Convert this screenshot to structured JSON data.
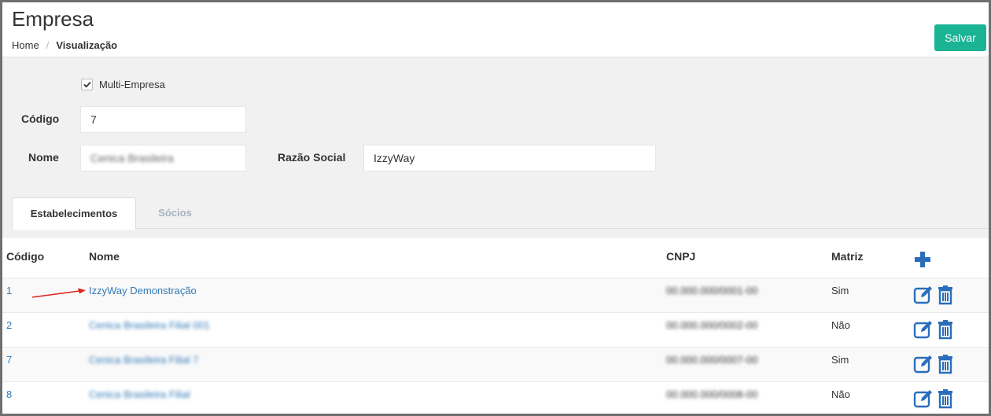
{
  "header": {
    "title": "Empresa",
    "breadcrumb_home": "Home",
    "breadcrumb_sep": "/",
    "breadcrumb_current": "Visualização",
    "save_label": "Salvar"
  },
  "form": {
    "multi_empresa_label": "Multi-Empresa",
    "multi_empresa_checked": true,
    "codigo_label": "Código",
    "codigo_value": "7",
    "nome_label": "Nome",
    "nome_value": "Cenica Brasileira",
    "razao_label": "Razão Social",
    "razao_value": "IzzyWay"
  },
  "tabs": [
    {
      "label": "Estabelecimentos",
      "active": true
    },
    {
      "label": "Sócios",
      "active": false
    }
  ],
  "table": {
    "headers": {
      "codigo": "Código",
      "nome": "Nome",
      "cnpj": "CNPJ",
      "matriz": "Matriz"
    },
    "rows": [
      {
        "codigo": "1",
        "nome": "IzzyWay Demonstração",
        "cnpj": "00.000.000/0001-00",
        "matriz": "Sim",
        "blurred": false
      },
      {
        "codigo": "2",
        "nome": "Cenica Brasileira Filial 001",
        "cnpj": "00.000.000/0002-00",
        "matriz": "Não",
        "blurred": true
      },
      {
        "codigo": "7",
        "nome": "Cenica Brasileira Filial 7",
        "cnpj": "00.000.000/0007-00",
        "matriz": "Sim",
        "blurred": true
      },
      {
        "codigo": "8",
        "nome": "Cenica Brasileira Filial",
        "cnpj": "00.000.000/0008-00",
        "matriz": "Não",
        "blurred": true
      }
    ]
  },
  "icons": {
    "add": "plus-icon",
    "edit": "edit-icon",
    "delete": "trash-icon"
  },
  "colors": {
    "accent": "#1ab394",
    "link": "#337ab7",
    "icon": "#2a6ebb",
    "arrow": "#d9261c"
  }
}
